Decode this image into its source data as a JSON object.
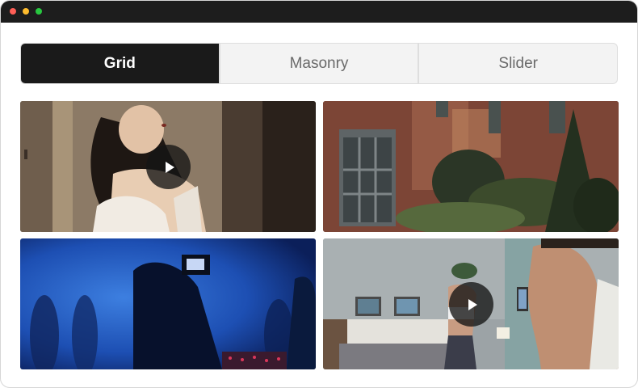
{
  "window": {
    "controls": [
      {
        "name": "close",
        "color": "#ff5f57"
      },
      {
        "name": "minimize",
        "color": "#febc2e"
      },
      {
        "name": "zoom",
        "color": "#28c840"
      }
    ]
  },
  "tabs": [
    {
      "label": "Grid",
      "active": true
    },
    {
      "label": "Masonry",
      "active": false
    },
    {
      "label": "Slider",
      "active": false
    }
  ],
  "gallery": {
    "items": [
      {
        "subject": "woman-portrait",
        "has_play": true
      },
      {
        "subject": "brick-house",
        "has_play": false
      },
      {
        "subject": "film-set-blue",
        "has_play": false
      },
      {
        "subject": "fitness-living-room",
        "has_play": true
      }
    ]
  }
}
